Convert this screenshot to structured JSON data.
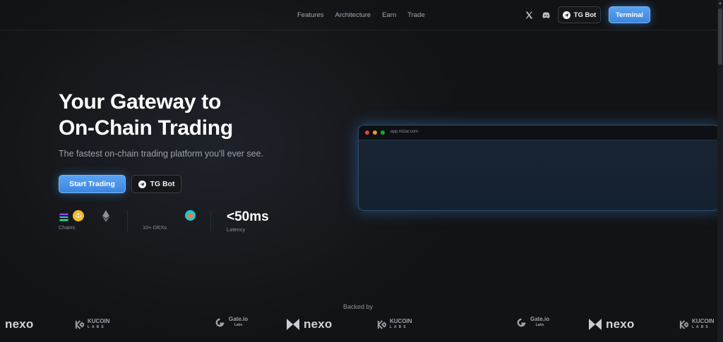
{
  "nav": {
    "items": [
      "Features",
      "Architecture",
      "Earn",
      "Trade"
    ],
    "tg_bot": "TG Bot",
    "terminal": "Terminal"
  },
  "hero": {
    "title_line1": "Your Gateway to",
    "title_line2": "On-Chain Trading",
    "subtitle": "The fastest on-chain trading platform you'll ever see.",
    "start_trading": "Start Trading",
    "tg_bot": "TG Bot"
  },
  "stats": {
    "chains_label": "Chains",
    "dexes_label": "10+ DEXs",
    "latency_value": "<50ms",
    "latency_label": "Latency"
  },
  "browser": {
    "url": "app.mizar.com"
  },
  "backed": {
    "label": "Backed by",
    "nexo": "nexo",
    "kucoin_top": "KUCOIN",
    "kucoin_bottom": "LABS",
    "gate_top": "Gate.io",
    "gate_bottom": "Labs"
  },
  "colors": {
    "accent": "#4a95ea",
    "background": "#121315"
  }
}
